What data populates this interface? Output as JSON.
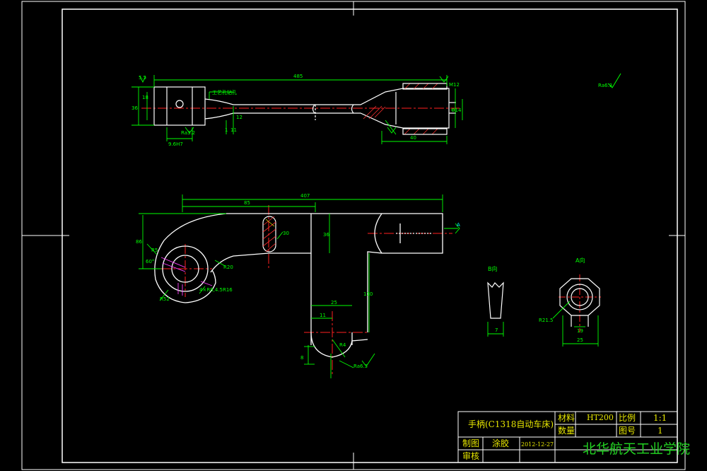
{
  "colors": {
    "background": "#000000",
    "frame": "#ffffff",
    "outline": "#ffffff",
    "dimension": "#00ff00",
    "centerline": "#ff2020",
    "hatch": "#ff3030",
    "hatch_alt": "#ffff00",
    "section_cut": "#ff40ff",
    "annotation": "#00ffff",
    "titleblock_text": "#e6e600",
    "school_text": "#22d322"
  },
  "top_view": {
    "overall_dim": "485",
    "left_dims": [
      "5.5",
      "18",
      "36"
    ],
    "bottom_dims": [
      "Ra3.2",
      "9.6H7",
      "1",
      "12",
      "11"
    ],
    "note": "工艺孔钻孔",
    "right_dims": [
      "M12",
      "40",
      "Φ14"
    ]
  },
  "front_view": {
    "overall_dim": "407",
    "upper_dim": "85",
    "left_dim": "86",
    "angle_dim": "60°",
    "radius_dims": [
      "R5",
      "R52",
      "R20"
    ],
    "hole_note": "4×R8,4.5R16",
    "slot_dim": "30",
    "height_dim": "36",
    "shaft_dims": [
      "25",
      "11",
      "110"
    ],
    "end_dims": [
      "8",
      "R4",
      "Ra6.3"
    ],
    "arrow_label": "A"
  },
  "roughness_mark": "Ra6.3",
  "view_b": {
    "label": "B向",
    "dim": "7"
  },
  "view_a": {
    "label": "A向",
    "dims": [
      "R21.5",
      "19",
      "25"
    ]
  },
  "title_block": {
    "part_name": "手柄(C1318自动车床)",
    "material_label": "材料",
    "material_value": "HT200",
    "scale_label": "比例",
    "scale_value": "1:1",
    "quantity_label": "数量",
    "drawing_no_label": "图号",
    "drawing_no_value": "1",
    "drawn_label": "制图",
    "drawn_name": "涂胶",
    "date": "2012-12-27",
    "reviewed_label": "审核",
    "school": "北华航天工业学院"
  }
}
